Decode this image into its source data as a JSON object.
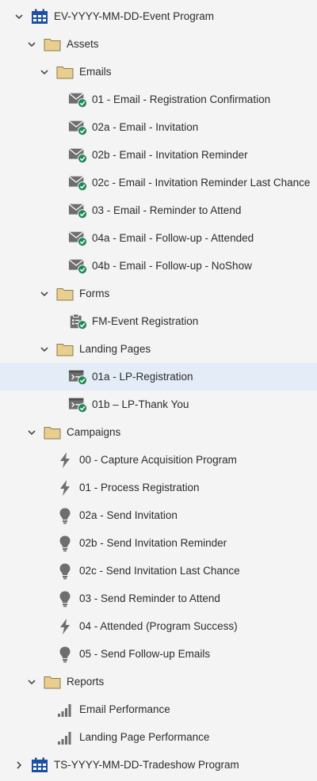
{
  "colors": {
    "background": "#f4f4f4",
    "selected_row": "#e3ecf7",
    "program_blue": "#1d4fa3",
    "folder_fill": "#e8cf8f",
    "folder_stroke": "#8a7a4a",
    "asset_gray": "#6e6e6e",
    "approved_green": "#1f8a55",
    "text": "#2c2c2c"
  },
  "tree": [
    {
      "label": "EV-YYYY-MM-DD-Event Program",
      "icon": "calendar-icon",
      "chevron": "down"
    },
    {
      "label": "Assets",
      "icon": "folder-icon",
      "chevron": "down"
    },
    {
      "label": "Emails",
      "icon": "folder-icon",
      "chevron": "down"
    },
    {
      "label": "01 - Email - Registration Confirmation",
      "icon": "email-approved-icon"
    },
    {
      "label": "02a - Email - Invitation",
      "icon": "email-approved-icon"
    },
    {
      "label": "02b - Email - Invitation Reminder",
      "icon": "email-approved-icon"
    },
    {
      "label": "02c - Email - Invitation Reminder Last Chance",
      "icon": "email-approved-icon"
    },
    {
      "label": "03 - Email - Reminder to Attend",
      "icon": "email-approved-icon"
    },
    {
      "label": "04a - Email - Follow-up - Attended",
      "icon": "email-approved-icon"
    },
    {
      "label": "04b - Email - Follow-up - NoShow",
      "icon": "email-approved-icon"
    },
    {
      "label": "Forms",
      "icon": "folder-icon",
      "chevron": "down"
    },
    {
      "label": "FM-Event Registration",
      "icon": "form-approved-icon"
    },
    {
      "label": "Landing Pages",
      "icon": "folder-icon",
      "chevron": "down"
    },
    {
      "label": "01a - LP-Registration",
      "icon": "landing-page-approved-icon",
      "selected": true
    },
    {
      "label": "01b – LP-Thank You",
      "icon": "landing-page-approved-icon"
    },
    {
      "label": "Campaigns",
      "icon": "folder-icon",
      "chevron": "down"
    },
    {
      "label": "00 - Capture Acquisition Program",
      "icon": "trigger-campaign-icon"
    },
    {
      "label": "01 - Process Registration",
      "icon": "trigger-campaign-icon"
    },
    {
      "label": "02a - Send Invitation",
      "icon": "batch-campaign-icon"
    },
    {
      "label": "02b - Send Invitation Reminder",
      "icon": "batch-campaign-icon"
    },
    {
      "label": "02c - Send Invitation Last Chance",
      "icon": "batch-campaign-icon"
    },
    {
      "label": "03 - Send Reminder to Attend",
      "icon": "batch-campaign-icon"
    },
    {
      "label": "04 - Attended (Program Success)",
      "icon": "trigger-campaign-icon"
    },
    {
      "label": "05 - Send Follow-up Emails",
      "icon": "batch-campaign-icon"
    },
    {
      "label": "Reports",
      "icon": "folder-icon",
      "chevron": "down"
    },
    {
      "label": "Email Performance",
      "icon": "report-icon"
    },
    {
      "label": "Landing Page Performance",
      "icon": "report-icon"
    },
    {
      "label": "TS-YYYY-MM-DD-Tradeshow Program",
      "icon": "calendar-icon",
      "chevron": "right"
    }
  ]
}
